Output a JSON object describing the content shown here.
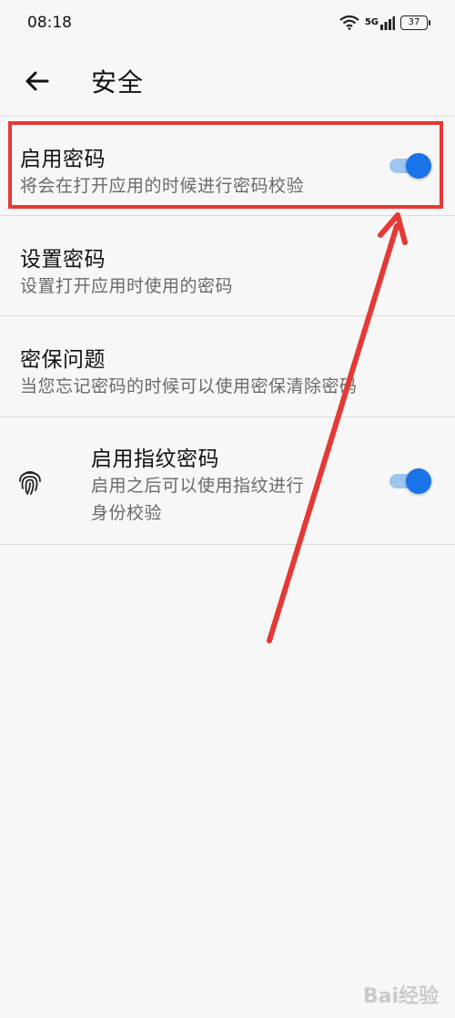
{
  "status_bar": {
    "time": "08:18",
    "network": "5G",
    "battery": "37"
  },
  "app_bar": {
    "title": "安全"
  },
  "settings": [
    {
      "title": "启用密码",
      "subtitle": "将会在打开应用的时候进行密码校验",
      "toggle": "on"
    },
    {
      "title": "设置密码",
      "subtitle": "设置打开应用时使用的密码"
    },
    {
      "title": "密保问题",
      "subtitle": "当您忘记密码的时候可以使用密保清除密码"
    },
    {
      "title": "启用指纹密码",
      "subtitle_line1": "启用之后可以使用指纹进行",
      "subtitle_line2": "身份校验",
      "toggle": "on",
      "icon": "fingerprint-icon"
    }
  ],
  "colors": {
    "accent": "#1a73e8",
    "annotation": "#e53935"
  },
  "watermark": "Bai经验"
}
